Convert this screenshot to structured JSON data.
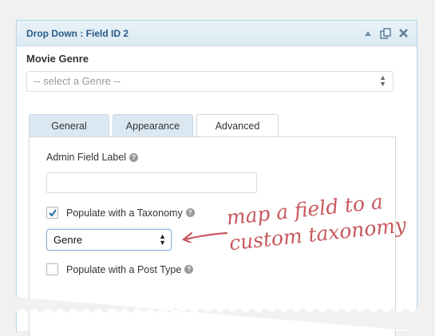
{
  "panel": {
    "title": "Drop Down : Field ID 2",
    "icons": [
      "collapse-icon",
      "duplicate-icon",
      "close-icon"
    ]
  },
  "field": {
    "label": "Movie Genre",
    "select_placeholder": "-- select a Genre --"
  },
  "tabs": [
    {
      "label": "General",
      "active": false
    },
    {
      "label": "Appearance",
      "active": false
    },
    {
      "label": "Advanced",
      "active": true
    }
  ],
  "advanced": {
    "admin_label": "Admin Field Label",
    "admin_value": "",
    "populate_taxonomy_label": "Populate with a Taxonomy",
    "populate_taxonomy_checked": true,
    "taxonomy_selected": "Genre",
    "populate_post_type_label": "Populate with a Post Type",
    "populate_post_type_checked": false
  },
  "annotation": {
    "line1": "map a field to a",
    "line2": "custom taxonomy"
  },
  "colors": {
    "accent_blue": "#2a5a86",
    "annotation_red": "#c7575d",
    "titlebar_bg": "#dbe9f3"
  }
}
